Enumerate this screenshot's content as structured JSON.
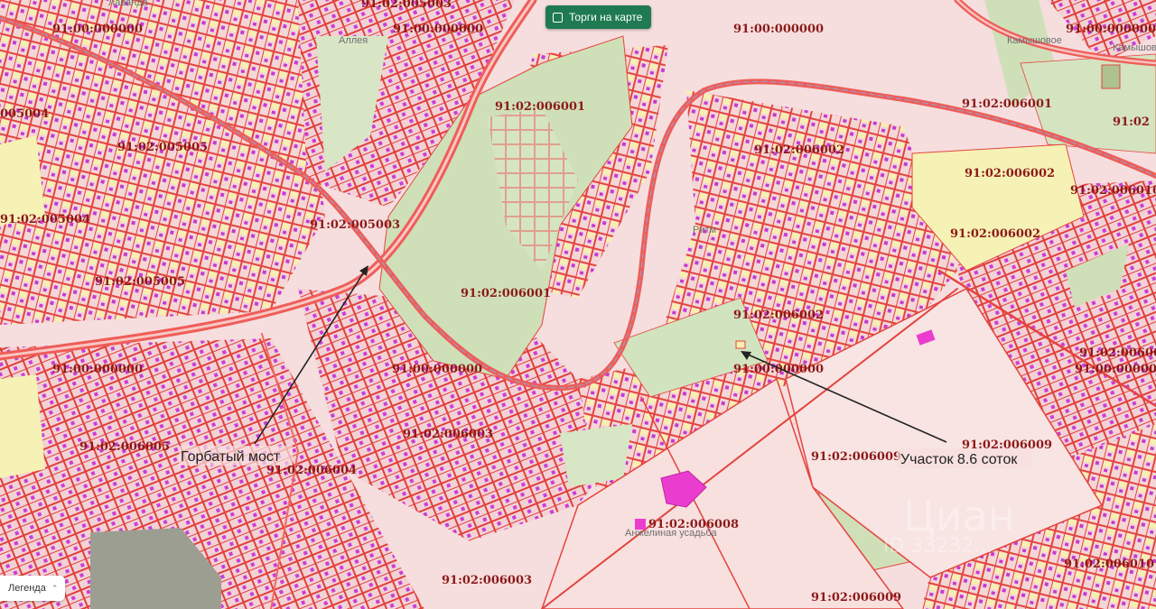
{
  "toolbar": {
    "auction_toggle_label": "Торги на карте",
    "auction_toggle_checked": false
  },
  "legend": {
    "label": "Легенда"
  },
  "place_labels": [
    "Лаванда",
    "Аллея",
    "Ритм",
    "Анжелиная усадьба",
    "Камышовое",
    "Камышов"
  ],
  "cadastral_labels": [
    "91:02:005003",
    "91:00:000000",
    "91:00:000000",
    "91:00:000000",
    "91:00:000000",
    "91:02:006001",
    "005004",
    "91:02:005005",
    "91:02:006002",
    "91:02:006001",
    "91:02:006002",
    "91:02:006002",
    "91:02:006010",
    "91:02:005004",
    "91:02:005003",
    "91:02:005005",
    "91:02:006001",
    "91:02:006002",
    "91:02:006001",
    "91:00:000000",
    "91:00:000000",
    "91:00:000000",
    "91:00:000000",
    "91:02:006003",
    "91:02:006005",
    "91:02:006009",
    "91:02:006009",
    "91:02:006004",
    "91:02:006008",
    "91:02:006003",
    "91:02:006010",
    "91:02:006009",
    "91:02"
  ],
  "annotations": {
    "bridge": "Горбатый мост",
    "plot": "Участок 8.6 соток"
  },
  "watermark": "Циан",
  "watermark_id": "ID 33232...",
  "colors": {
    "base": "#f6dede",
    "parcel_fill": "#f3d4d4",
    "parcel_border": "#e4443f",
    "building": "#c33bd6",
    "green": "#cfe0b8",
    "yellow": "#f6f1b4",
    "road": "#ef5d58",
    "rail": "#9b9bc6",
    "button": "#1f7a52",
    "magenta": "#ea3dcf"
  }
}
